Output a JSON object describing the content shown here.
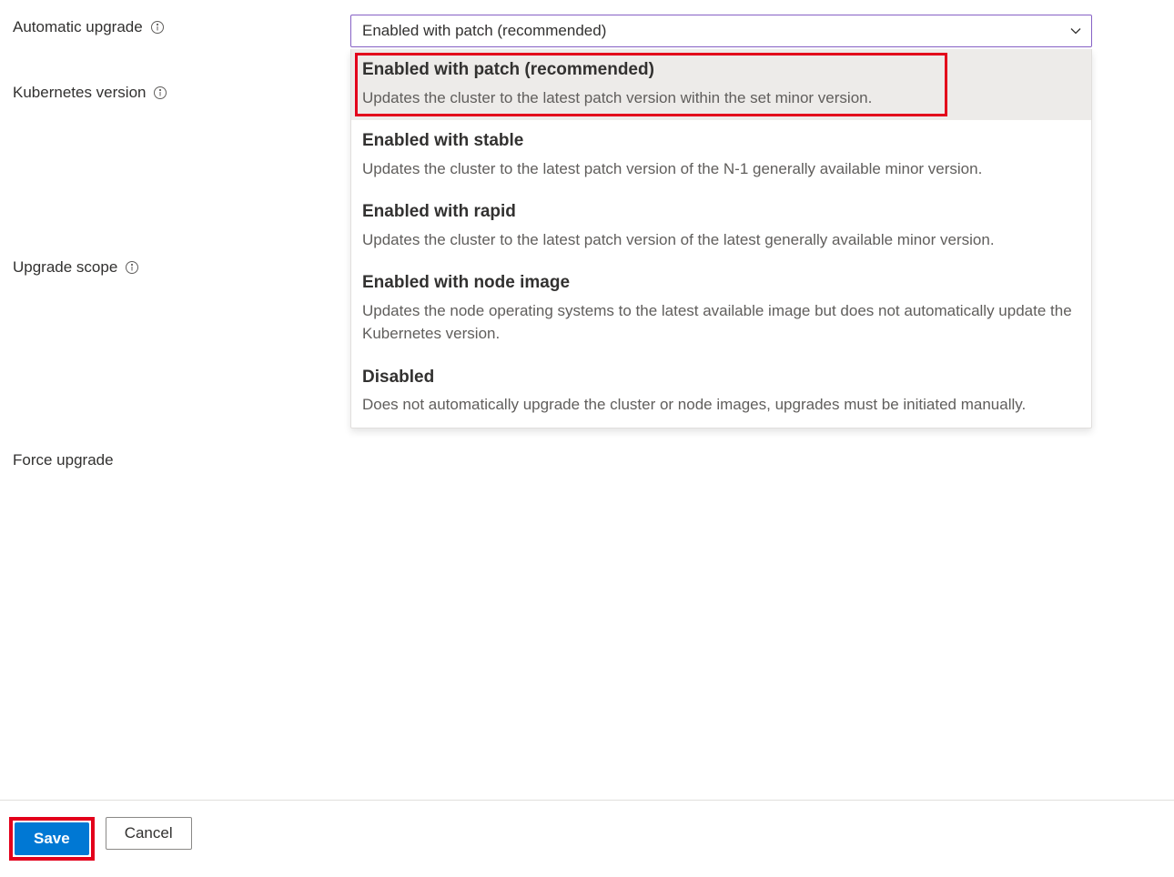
{
  "labels": {
    "automatic_upgrade": "Automatic upgrade",
    "kubernetes_version": "Kubernetes version",
    "upgrade_scope": "Upgrade scope",
    "force_upgrade": "Force upgrade"
  },
  "dropdown": {
    "selected": "Enabled with patch (recommended)",
    "options": [
      {
        "title": "Enabled with patch (recommended)",
        "desc": "Updates the cluster to the latest patch version within the set minor version."
      },
      {
        "title": "Enabled with stable",
        "desc": "Updates the cluster to the latest patch version of the N-1 generally available minor version."
      },
      {
        "title": "Enabled with rapid",
        "desc": "Updates the cluster to the latest patch version of the latest generally available minor version."
      },
      {
        "title": "Enabled with node image",
        "desc": "Updates the node operating systems to the latest available image but does not automatically update the Kubernetes version."
      },
      {
        "title": "Disabled",
        "desc": "Does not automatically upgrade the cluster or node images, upgrades must be initiated manually."
      }
    ]
  },
  "buttons": {
    "save": "Save",
    "cancel": "Cancel"
  }
}
